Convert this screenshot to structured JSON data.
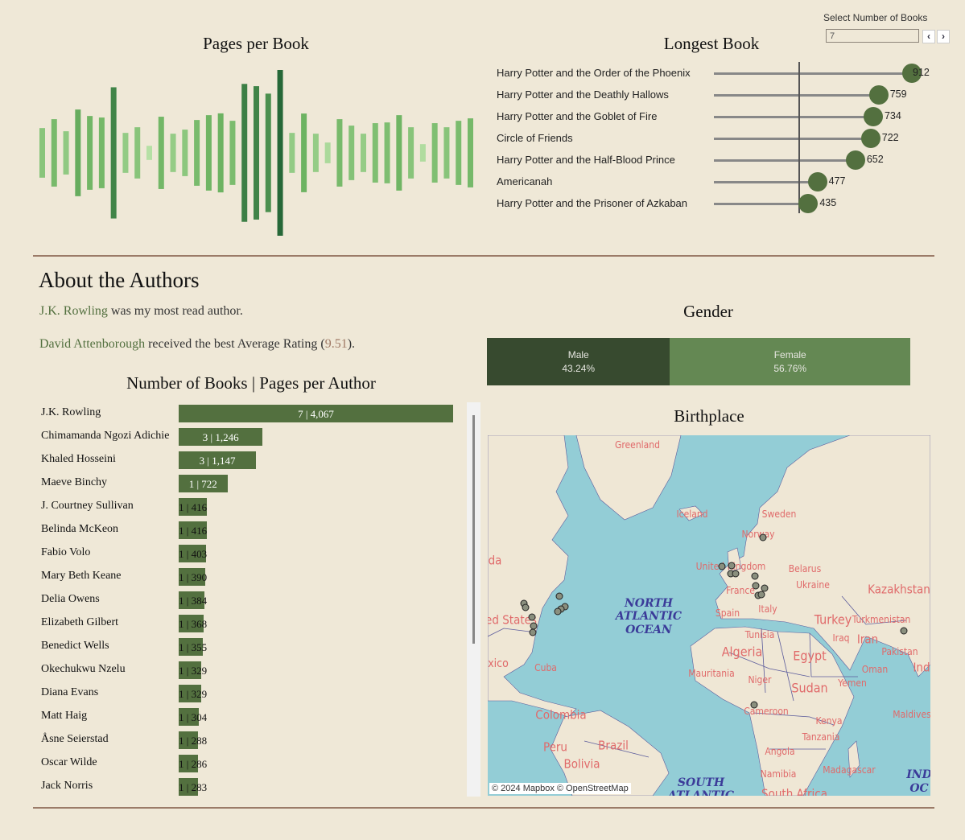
{
  "colors": {
    "background": "#efe8d7",
    "accent_green": "#53703f",
    "male": "#374a2f",
    "female": "#648853",
    "divider": "#9b7b68",
    "highlight_rating": "#a07a66",
    "map_water": "#93cdd6",
    "map_label": "#e06a6a",
    "ocean_label": "#3b3b99"
  },
  "filter": {
    "label": "Select Number of Books",
    "value": "7",
    "prev_icon": "chevron-left-icon",
    "next_icon": "chevron-right-icon",
    "prev": "‹",
    "next": "›"
  },
  "pages_per_book": {
    "title": "Pages per Book",
    "chart_data": {
      "type": "bar",
      "orientation": "vertical-centered",
      "values": [
        273,
        371,
        238,
        477,
        406,
        389,
        722,
        220,
        282,
        78,
        398,
        211,
        256,
        362,
        415,
        435,
        353,
        759,
        734,
        652,
        912,
        220,
        433,
        211,
        114,
        371,
        300,
        211,
        327,
        335,
        415,
        282,
        96,
        327,
        282,
        353,
        380
      ]
    }
  },
  "longest_book": {
    "title": "Longest Book",
    "chart_data": {
      "type": "lollipop",
      "reference_line": 388,
      "xlim": [
        0,
        912
      ],
      "items": [
        {
          "title": "Harry Potter and the Order of the Phoenix",
          "pages": 912
        },
        {
          "title": "Harry Potter and the Deathly Hallows",
          "pages": 759
        },
        {
          "title": "Harry Potter and the Goblet of Fire",
          "pages": 734
        },
        {
          "title": "Circle of Friends",
          "pages": 722
        },
        {
          "title": "Harry Potter and the Half-Blood Prince",
          "pages": 652
        },
        {
          "title": "Americanah",
          "pages": 477
        },
        {
          "title": "Harry Potter and the Prisoner of Azkaban",
          "pages": 435
        }
      ]
    }
  },
  "about": {
    "heading": "About the Authors",
    "most_read_author": "J.K. Rowling",
    "most_read_suffix": " was my most read author.",
    "best_rated_author": "David Attenborough",
    "best_rated_middle": " received the best Average Rating (",
    "best_rating": "9.51",
    "best_rated_end": ")."
  },
  "authors": {
    "title": "Number of Books | Pages per Author",
    "chart_data": {
      "type": "bar",
      "orientation": "horizontal",
      "items": [
        {
          "name": "J.K. Rowling",
          "books": 7,
          "pages": 4067,
          "label": "7 | 4,067"
        },
        {
          "name": "Chimamanda Ngozi Adichie",
          "books": 3,
          "pages": 1246,
          "label": "3 | 1,246"
        },
        {
          "name": "Khaled Hosseini",
          "books": 3,
          "pages": 1147,
          "label": "3 | 1,147"
        },
        {
          "name": "Maeve Binchy",
          "books": 1,
          "pages": 722,
          "label": "1 | 722"
        },
        {
          "name": "J. Courtney Sullivan",
          "books": 1,
          "pages": 416,
          "label": "1 | 416"
        },
        {
          "name": "Belinda McKeon",
          "books": 1,
          "pages": 416,
          "label": "1 | 416"
        },
        {
          "name": "Fabio Volo",
          "books": 1,
          "pages": 403,
          "label": "1 | 403"
        },
        {
          "name": "Mary Beth Keane",
          "books": 1,
          "pages": 390,
          "label": "1 | 390"
        },
        {
          "name": "Delia Owens",
          "books": 1,
          "pages": 384,
          "label": "1 | 384"
        },
        {
          "name": "Elizabeth Gilbert",
          "books": 1,
          "pages": 368,
          "label": "1 | 368"
        },
        {
          "name": "Benedict Wells",
          "books": 1,
          "pages": 355,
          "label": "1 | 355"
        },
        {
          "name": "Okechukwu Nzelu",
          "books": 1,
          "pages": 329,
          "label": "1 | 329"
        },
        {
          "name": "Diana Evans",
          "books": 1,
          "pages": 329,
          "label": "1 | 329"
        },
        {
          "name": "Matt Haig",
          "books": 1,
          "pages": 304,
          "label": "1 | 304"
        },
        {
          "name": "Åsne Seierstad",
          "books": 1,
          "pages": 288,
          "label": "1 | 288"
        },
        {
          "name": "Oscar Wilde",
          "books": 1,
          "pages": 286,
          "label": "1 | 286"
        },
        {
          "name": "Jack Norris",
          "books": 1,
          "pages": 283,
          "label": "1 | 283"
        }
      ]
    }
  },
  "gender": {
    "title": "Gender",
    "chart_data": {
      "type": "stacked-bar",
      "segments": [
        {
          "label": "Male",
          "percent": 43.24,
          "text": "43.24%"
        },
        {
          "label": "Female",
          "percent": 56.76,
          "text": "56.76%"
        }
      ]
    }
  },
  "birthplace": {
    "title": "Birthplace",
    "attribution": "© 2024 Mapbox © OpenStreetMap",
    "labels": [
      "Greenland",
      "Iceland",
      "Sweden",
      "Norway",
      "United Kingdom",
      "Belarus",
      "Ukraine",
      "Kazakhstan",
      "France",
      "Italy",
      "Spain",
      "Turkey",
      "Turkmenistan",
      "Tunisia",
      "Iraq",
      "Iran",
      "Algeria",
      "Egypt",
      "Pakistan",
      "Oman",
      "Ind",
      "Mauritania",
      "Niger",
      "Yemen",
      "Sudan",
      "Cameroon",
      "Maldives",
      "Colombia",
      "Kenya",
      "Tanzania",
      "Peru",
      "Brazil",
      "Bolivia",
      "Angola",
      "Namibia",
      "Madagascar",
      "South Africa",
      "Cuba",
      "xico",
      "ed States",
      "da"
    ],
    "ocean_labels": [
      "NORTH",
      "ATLANTIC",
      "OCEAN",
      "SOUTH",
      "ATLANTIC",
      "IND",
      "OC"
    ]
  }
}
